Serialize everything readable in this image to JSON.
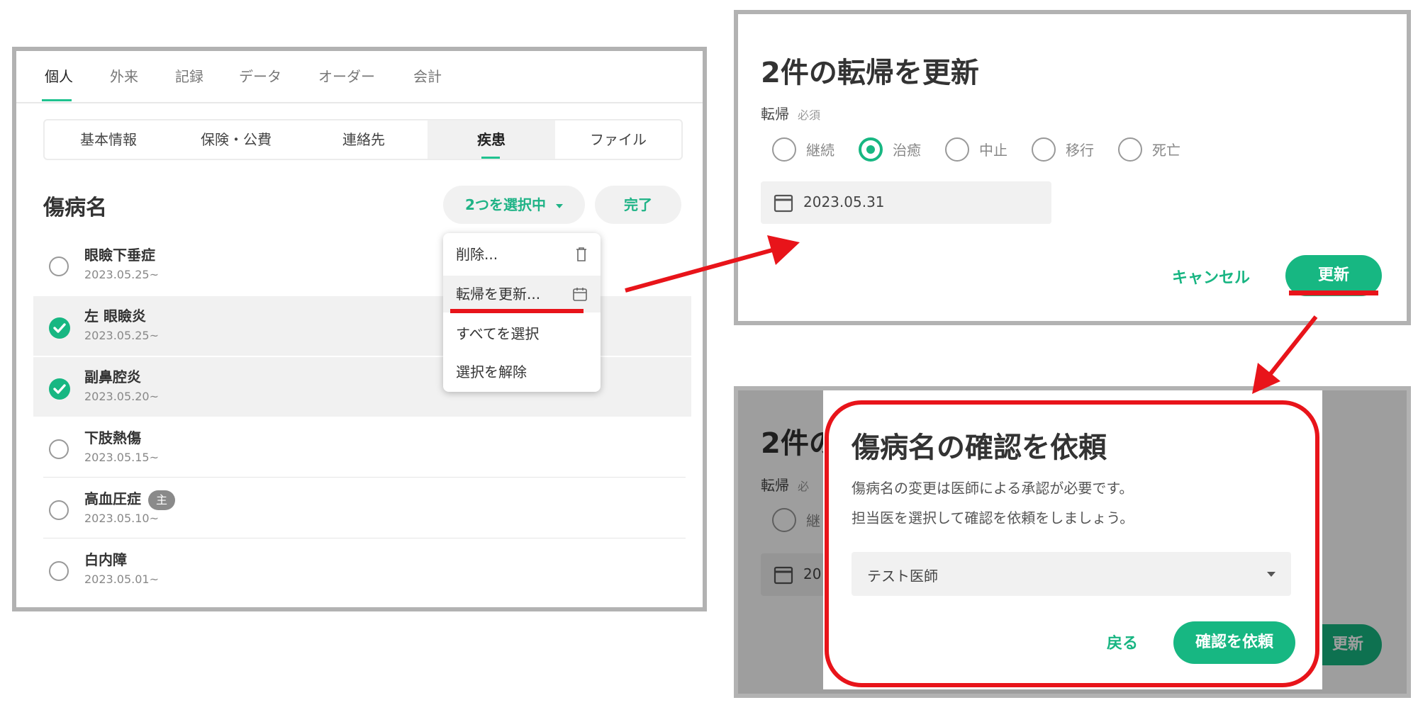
{
  "panel1": {
    "tabs": [
      "個人",
      "外来",
      "記録",
      "データ",
      "オーダー",
      "会計"
    ],
    "active_tab": "個人",
    "subtabs": [
      "基本情報",
      "保険・公費",
      "連絡先",
      "疾患",
      "ファイル"
    ],
    "active_subtab": "疾患",
    "section_title": "傷病名",
    "selection_button": "2つを選択中",
    "done_button": "完了",
    "menu": {
      "delete": "削除...",
      "update_outcome": "転帰を更新...",
      "select_all": "すべてを選択",
      "deselect": "選択を解除"
    },
    "diseases": [
      {
        "name": "眼瞼下垂症",
        "date": "2023.05.25~",
        "checked": false
      },
      {
        "name": "左 眼瞼炎",
        "date": "2023.05.25~",
        "checked": true
      },
      {
        "name": "副鼻腔炎",
        "date": "2023.05.20~",
        "checked": true
      },
      {
        "name": "下肢熱傷",
        "date": "2023.05.15~",
        "checked": false
      },
      {
        "name": "高血圧症",
        "date": "2023.05.10~",
        "checked": false,
        "badge": "主"
      },
      {
        "name": "白内障",
        "date": "2023.05.01~",
        "checked": false
      }
    ]
  },
  "panel2": {
    "title": "2件の転帰を更新",
    "label": "転帰",
    "required": "必須",
    "options": [
      "継続",
      "治癒",
      "中止",
      "移行",
      "死亡"
    ],
    "selected_option": "治癒",
    "date": "2023.05.31",
    "cancel": "キャンセル",
    "update": "更新"
  },
  "panel3": {
    "background_title": "2件の",
    "background_label": "転帰",
    "background_required": "必",
    "background_radio": "継",
    "background_date": "20",
    "background_button": "更新",
    "dialog_title": "傷病名の確認を依頼",
    "message_line1": "傷病名の変更は医師による承認が必要です。",
    "message_line2": "担当医を選択して確認を依頼をしましょう。",
    "doctor": "テスト医師",
    "back": "戻る",
    "request": "確認を依頼"
  },
  "colors": {
    "accent_green": "#17b782",
    "annotation_red": "#e8141a",
    "border_gray": "#b2b2b2"
  }
}
